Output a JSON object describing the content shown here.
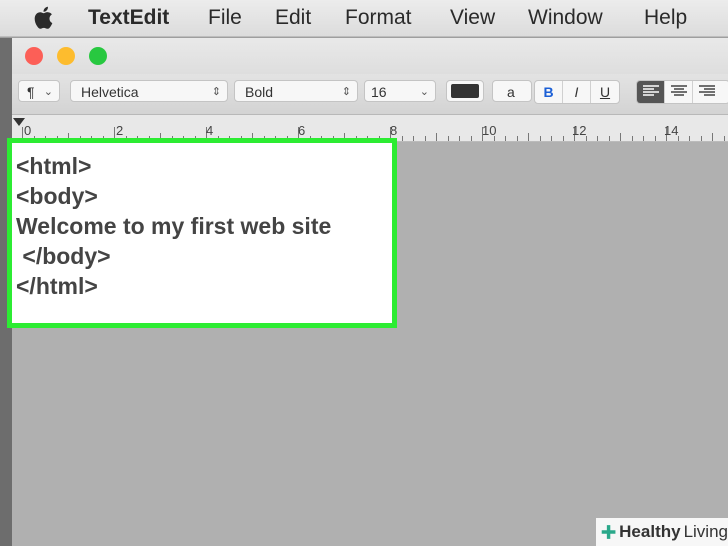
{
  "menubar": {
    "app_name": "TextEdit",
    "items": [
      "File",
      "Edit",
      "Format",
      "View",
      "Window",
      "Help"
    ],
    "apple_icon": "apple-icon"
  },
  "window": {
    "traffic_lights": {
      "close": "#fc5f57",
      "minimize": "#fdbc2e",
      "zoom": "#28c840"
    },
    "toolbar": {
      "paragraph_label": "¶",
      "font_family": "Helvetica",
      "font_style": "Bold",
      "font_size": "16",
      "highlight_label": "a",
      "bold_label": "B",
      "italic_label": "I",
      "underline_label": "U"
    },
    "ruler": {
      "labels": [
        "0",
        "2",
        "4",
        "6",
        "8",
        "10",
        "12",
        "14"
      ]
    }
  },
  "document": {
    "lines": [
      "<html>",
      "<body>",
      "Welcome to my first web site",
      " </body>",
      "</html>"
    ],
    "highlight_color": "#2cec32"
  },
  "watermark": {
    "healthy": "Healthy",
    "living": "Living"
  }
}
